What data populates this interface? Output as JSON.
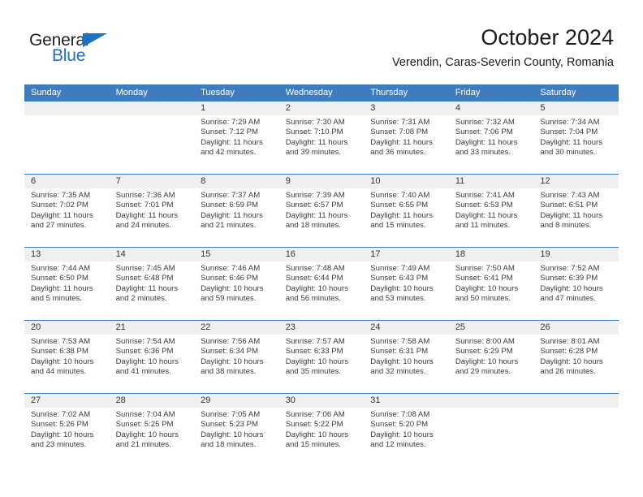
{
  "brand": {
    "name_part1": "General",
    "name_part2": "Blue",
    "accent_color": "#1f72bd"
  },
  "header": {
    "title": "October 2024",
    "subtitle": "Verendin, Caras-Severin County, Romania"
  },
  "theme": {
    "header_blue": "#3d7dbf",
    "date_band_gray": "#f0f0f0",
    "text_color": "#3b3b3b"
  },
  "calendar": {
    "weekdays": [
      "Sunday",
      "Monday",
      "Tuesday",
      "Wednesday",
      "Thursday",
      "Friday",
      "Saturday"
    ],
    "weeks": [
      {
        "days": [
          {
            "date": "",
            "sunrise": "",
            "sunset": "",
            "daylight_line1": "",
            "daylight_line2": ""
          },
          {
            "date": "",
            "sunrise": "",
            "sunset": "",
            "daylight_line1": "",
            "daylight_line2": ""
          },
          {
            "date": "1",
            "sunrise": "Sunrise: 7:29 AM",
            "sunset": "Sunset: 7:12 PM",
            "daylight_line1": "Daylight: 11 hours",
            "daylight_line2": "and 42 minutes."
          },
          {
            "date": "2",
            "sunrise": "Sunrise: 7:30 AM",
            "sunset": "Sunset: 7:10 PM",
            "daylight_line1": "Daylight: 11 hours",
            "daylight_line2": "and 39 minutes."
          },
          {
            "date": "3",
            "sunrise": "Sunrise: 7:31 AM",
            "sunset": "Sunset: 7:08 PM",
            "daylight_line1": "Daylight: 11 hours",
            "daylight_line2": "and 36 minutes."
          },
          {
            "date": "4",
            "sunrise": "Sunrise: 7:32 AM",
            "sunset": "Sunset: 7:06 PM",
            "daylight_line1": "Daylight: 11 hours",
            "daylight_line2": "and 33 minutes."
          },
          {
            "date": "5",
            "sunrise": "Sunrise: 7:34 AM",
            "sunset": "Sunset: 7:04 PM",
            "daylight_line1": "Daylight: 11 hours",
            "daylight_line2": "and 30 minutes."
          }
        ]
      },
      {
        "days": [
          {
            "date": "6",
            "sunrise": "Sunrise: 7:35 AM",
            "sunset": "Sunset: 7:02 PM",
            "daylight_line1": "Daylight: 11 hours",
            "daylight_line2": "and 27 minutes."
          },
          {
            "date": "7",
            "sunrise": "Sunrise: 7:36 AM",
            "sunset": "Sunset: 7:01 PM",
            "daylight_line1": "Daylight: 11 hours",
            "daylight_line2": "and 24 minutes."
          },
          {
            "date": "8",
            "sunrise": "Sunrise: 7:37 AM",
            "sunset": "Sunset: 6:59 PM",
            "daylight_line1": "Daylight: 11 hours",
            "daylight_line2": "and 21 minutes."
          },
          {
            "date": "9",
            "sunrise": "Sunrise: 7:39 AM",
            "sunset": "Sunset: 6:57 PM",
            "daylight_line1": "Daylight: 11 hours",
            "daylight_line2": "and 18 minutes."
          },
          {
            "date": "10",
            "sunrise": "Sunrise: 7:40 AM",
            "sunset": "Sunset: 6:55 PM",
            "daylight_line1": "Daylight: 11 hours",
            "daylight_line2": "and 15 minutes."
          },
          {
            "date": "11",
            "sunrise": "Sunrise: 7:41 AM",
            "sunset": "Sunset: 6:53 PM",
            "daylight_line1": "Daylight: 11 hours",
            "daylight_line2": "and 11 minutes."
          },
          {
            "date": "12",
            "sunrise": "Sunrise: 7:43 AM",
            "sunset": "Sunset: 6:51 PM",
            "daylight_line1": "Daylight: 11 hours",
            "daylight_line2": "and 8 minutes."
          }
        ]
      },
      {
        "days": [
          {
            "date": "13",
            "sunrise": "Sunrise: 7:44 AM",
            "sunset": "Sunset: 6:50 PM",
            "daylight_line1": "Daylight: 11 hours",
            "daylight_line2": "and 5 minutes."
          },
          {
            "date": "14",
            "sunrise": "Sunrise: 7:45 AM",
            "sunset": "Sunset: 6:48 PM",
            "daylight_line1": "Daylight: 11 hours",
            "daylight_line2": "and 2 minutes."
          },
          {
            "date": "15",
            "sunrise": "Sunrise: 7:46 AM",
            "sunset": "Sunset: 6:46 PM",
            "daylight_line1": "Daylight: 10 hours",
            "daylight_line2": "and 59 minutes."
          },
          {
            "date": "16",
            "sunrise": "Sunrise: 7:48 AM",
            "sunset": "Sunset: 6:44 PM",
            "daylight_line1": "Daylight: 10 hours",
            "daylight_line2": "and 56 minutes."
          },
          {
            "date": "17",
            "sunrise": "Sunrise: 7:49 AM",
            "sunset": "Sunset: 6:43 PM",
            "daylight_line1": "Daylight: 10 hours",
            "daylight_line2": "and 53 minutes."
          },
          {
            "date": "18",
            "sunrise": "Sunrise: 7:50 AM",
            "sunset": "Sunset: 6:41 PM",
            "daylight_line1": "Daylight: 10 hours",
            "daylight_line2": "and 50 minutes."
          },
          {
            "date": "19",
            "sunrise": "Sunrise: 7:52 AM",
            "sunset": "Sunset: 6:39 PM",
            "daylight_line1": "Daylight: 10 hours",
            "daylight_line2": "and 47 minutes."
          }
        ]
      },
      {
        "days": [
          {
            "date": "20",
            "sunrise": "Sunrise: 7:53 AM",
            "sunset": "Sunset: 6:38 PM",
            "daylight_line1": "Daylight: 10 hours",
            "daylight_line2": "and 44 minutes."
          },
          {
            "date": "21",
            "sunrise": "Sunrise: 7:54 AM",
            "sunset": "Sunset: 6:36 PM",
            "daylight_line1": "Daylight: 10 hours",
            "daylight_line2": "and 41 minutes."
          },
          {
            "date": "22",
            "sunrise": "Sunrise: 7:56 AM",
            "sunset": "Sunset: 6:34 PM",
            "daylight_line1": "Daylight: 10 hours",
            "daylight_line2": "and 38 minutes."
          },
          {
            "date": "23",
            "sunrise": "Sunrise: 7:57 AM",
            "sunset": "Sunset: 6:33 PM",
            "daylight_line1": "Daylight: 10 hours",
            "daylight_line2": "and 35 minutes."
          },
          {
            "date": "24",
            "sunrise": "Sunrise: 7:58 AM",
            "sunset": "Sunset: 6:31 PM",
            "daylight_line1": "Daylight: 10 hours",
            "daylight_line2": "and 32 minutes."
          },
          {
            "date": "25",
            "sunrise": "Sunrise: 8:00 AM",
            "sunset": "Sunset: 6:29 PM",
            "daylight_line1": "Daylight: 10 hours",
            "daylight_line2": "and 29 minutes."
          },
          {
            "date": "26",
            "sunrise": "Sunrise: 8:01 AM",
            "sunset": "Sunset: 6:28 PM",
            "daylight_line1": "Daylight: 10 hours",
            "daylight_line2": "and 26 minutes."
          }
        ]
      },
      {
        "days": [
          {
            "date": "27",
            "sunrise": "Sunrise: 7:02 AM",
            "sunset": "Sunset: 5:26 PM",
            "daylight_line1": "Daylight: 10 hours",
            "daylight_line2": "and 23 minutes."
          },
          {
            "date": "28",
            "sunrise": "Sunrise: 7:04 AM",
            "sunset": "Sunset: 5:25 PM",
            "daylight_line1": "Daylight: 10 hours",
            "daylight_line2": "and 21 minutes."
          },
          {
            "date": "29",
            "sunrise": "Sunrise: 7:05 AM",
            "sunset": "Sunset: 5:23 PM",
            "daylight_line1": "Daylight: 10 hours",
            "daylight_line2": "and 18 minutes."
          },
          {
            "date": "30",
            "sunrise": "Sunrise: 7:06 AM",
            "sunset": "Sunset: 5:22 PM",
            "daylight_line1": "Daylight: 10 hours",
            "daylight_line2": "and 15 minutes."
          },
          {
            "date": "31",
            "sunrise": "Sunrise: 7:08 AM",
            "sunset": "Sunset: 5:20 PM",
            "daylight_line1": "Daylight: 10 hours",
            "daylight_line2": "and 12 minutes."
          },
          {
            "date": "",
            "sunrise": "",
            "sunset": "",
            "daylight_line1": "",
            "daylight_line2": ""
          },
          {
            "date": "",
            "sunrise": "",
            "sunset": "",
            "daylight_line1": "",
            "daylight_line2": ""
          }
        ]
      }
    ]
  }
}
